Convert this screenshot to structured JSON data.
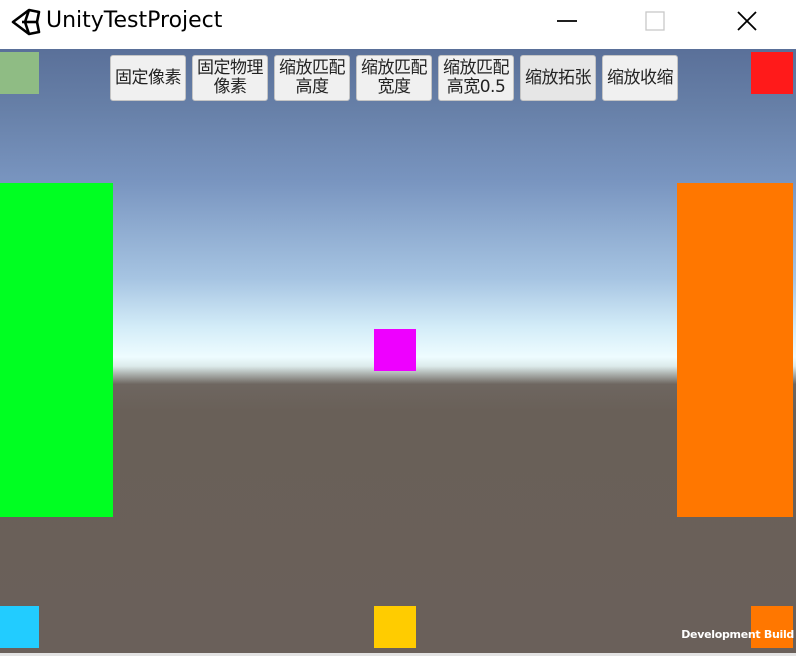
{
  "window": {
    "title": "UnityTestProject",
    "app_icon": "unity-logo-icon",
    "controls": {
      "minimize_icon": "minimize-icon",
      "maximize_icon": "maximize-icon",
      "close_icon": "close-icon"
    }
  },
  "toolbar": {
    "buttons": [
      {
        "label": "固定像素"
      },
      {
        "label": "固定物理\n像素"
      },
      {
        "label": "缩放匹配\n高度"
      },
      {
        "label": "缩放匹配\n宽度"
      },
      {
        "label": "缩放匹配\n高宽0.5"
      },
      {
        "label": "缩放拓张"
      },
      {
        "label": "缩放收缩"
      }
    ]
  },
  "scene": {
    "colors": {
      "top_left": "#8fbc84",
      "top_right": "#ff1a1a",
      "left_panel": "#00ff22",
      "right_panel": "#ff7700",
      "center": "#ee00ff",
      "bottom_left": "#22ccff",
      "bottom_center": "#ffcc00",
      "bottom_right": "#ff7700"
    },
    "watermark": "Development Build"
  }
}
